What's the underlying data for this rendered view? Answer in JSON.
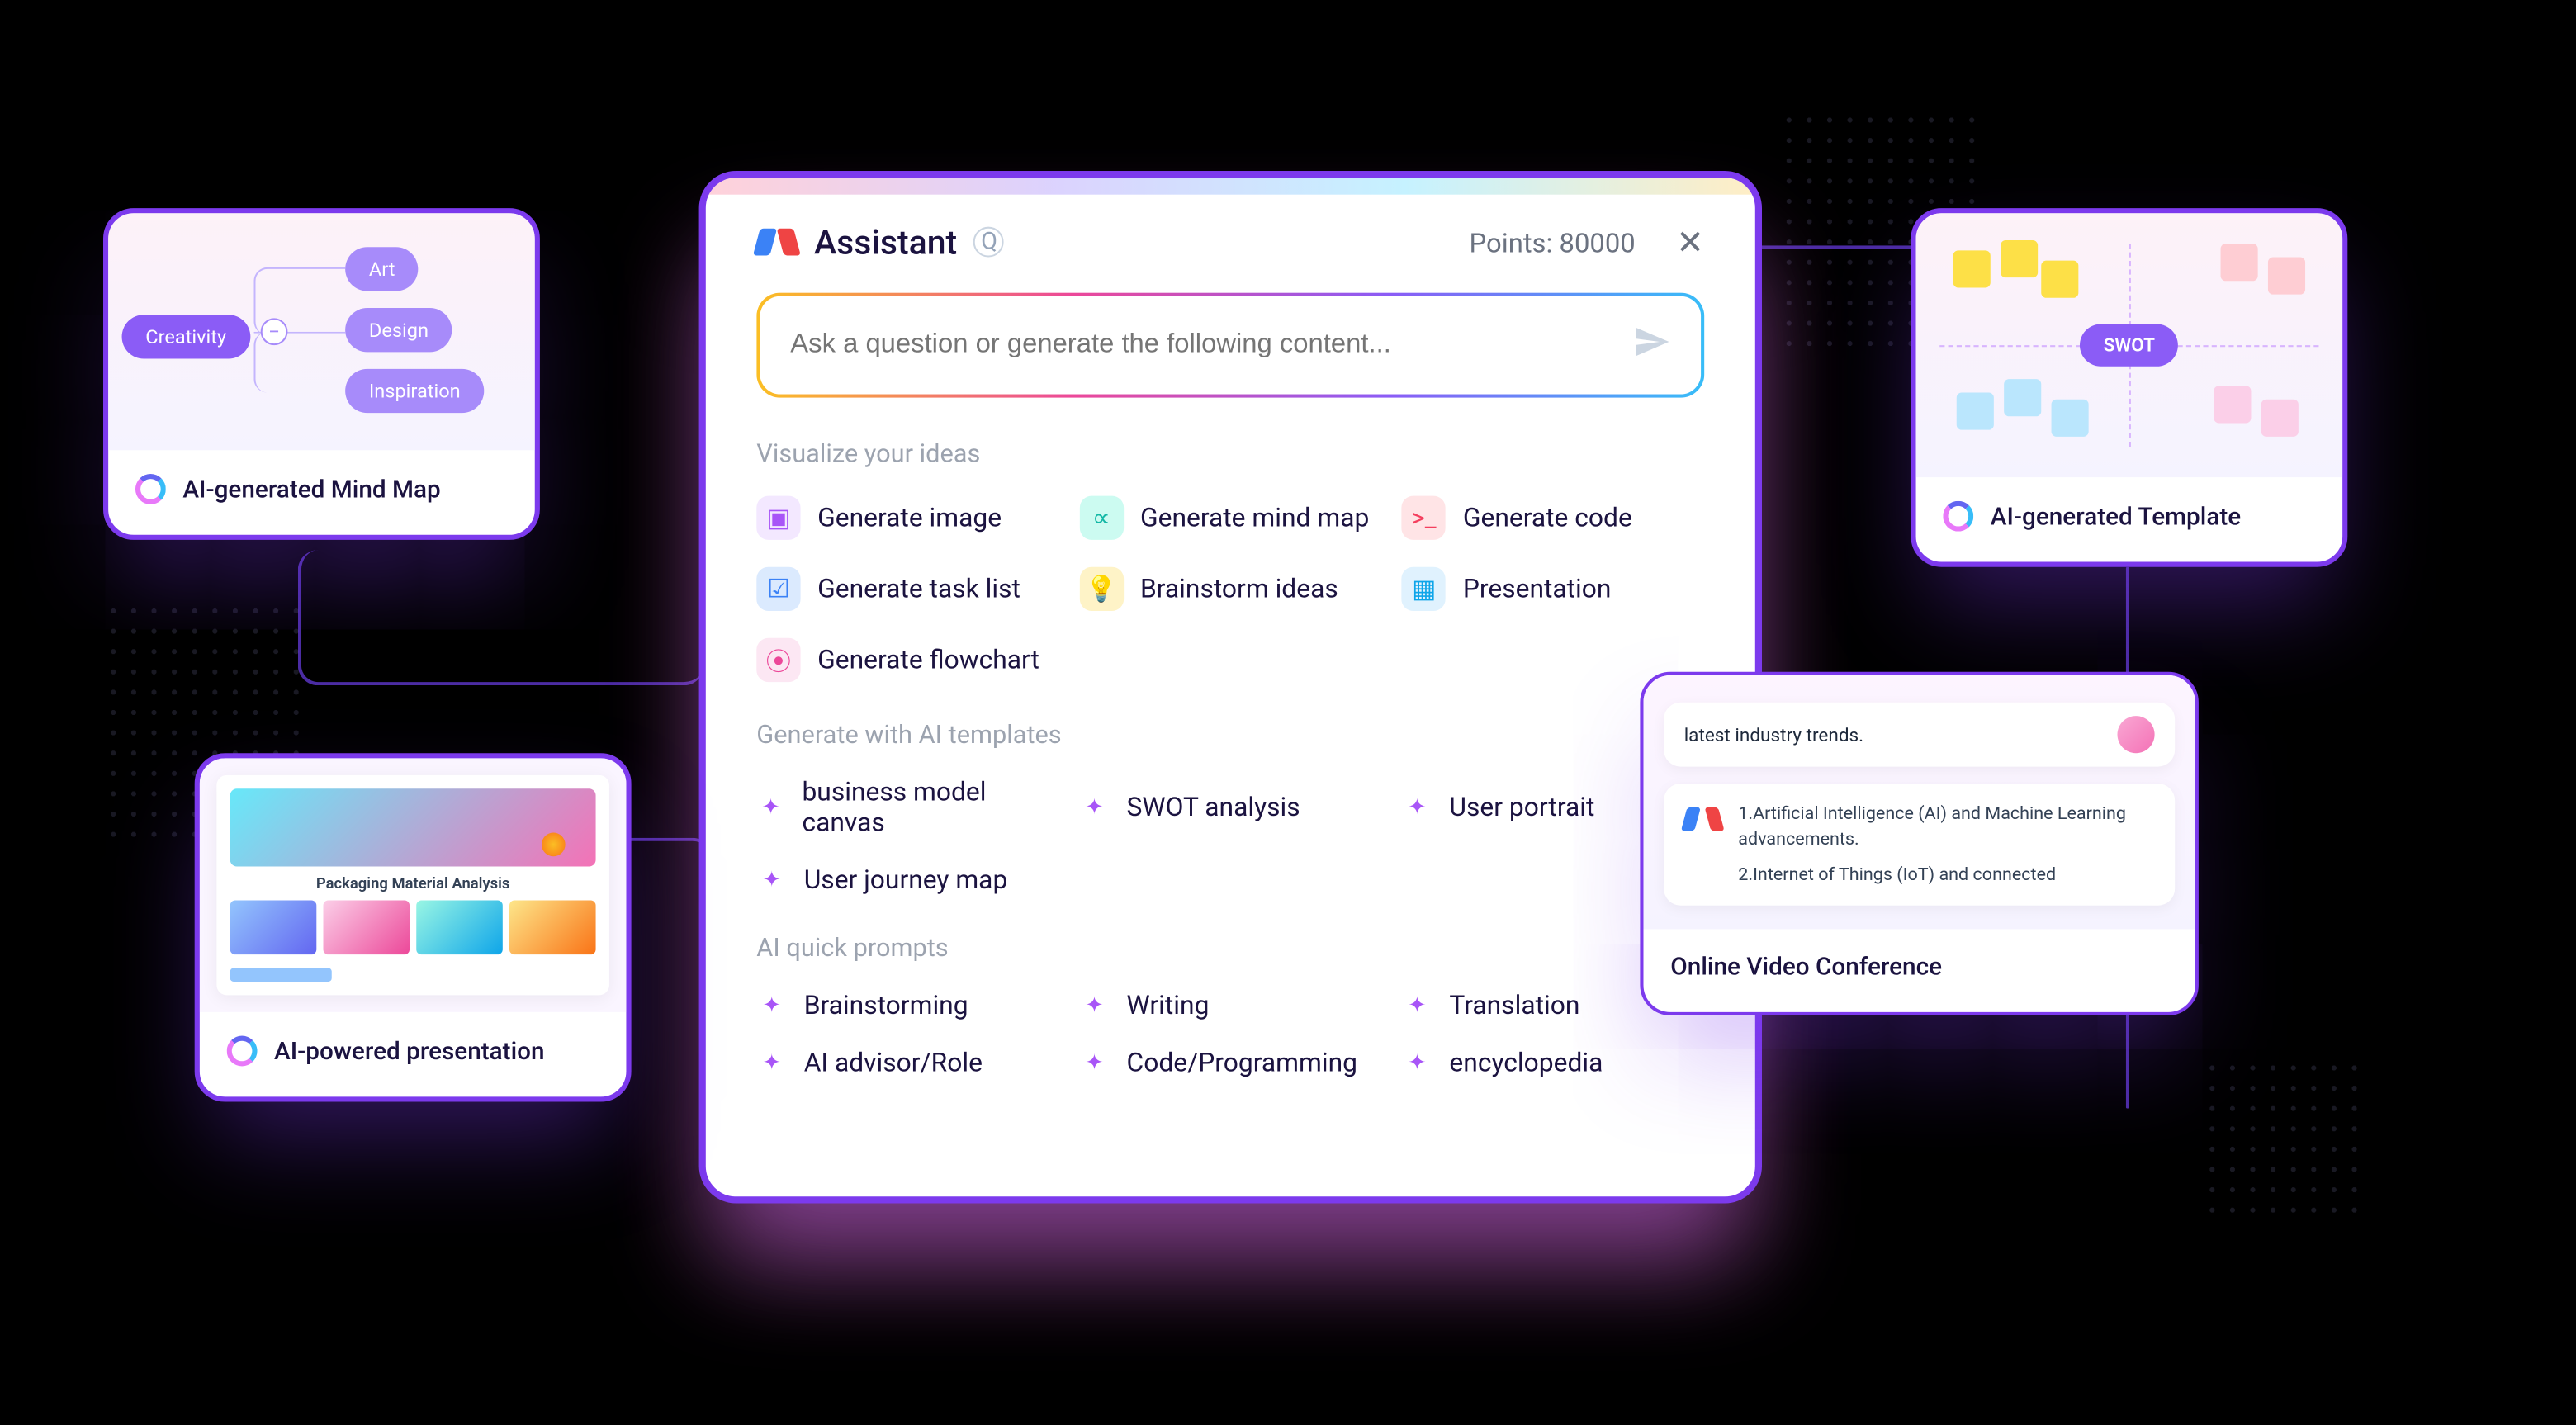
{
  "main": {
    "title": "Assistant",
    "points_label": "Points: 80000",
    "input_placeholder": "Ask a question or generate the following content...",
    "sections": {
      "visualize": {
        "heading": "Visualize your ideas",
        "items": {
          "image": "Generate image",
          "mindmap": "Generate mind map",
          "code": "Generate code",
          "tasklist": "Generate task list",
          "brainstorm": "Brainstorm ideas",
          "present": "Presentation",
          "flowchart": "Generate flowchart"
        }
      },
      "templates": {
        "heading": "Generate with AI templates",
        "items": {
          "bmc": "business model canvas",
          "swot": "SWOT analysis",
          "persona": "User portrait",
          "journey": "User journey map"
        }
      },
      "prompts": {
        "heading": "AI quick prompts",
        "items": {
          "brainstorm": "Brainstorming",
          "writing": "Writing",
          "translate": "Translation",
          "advisor": "AI advisor/Role",
          "codeprog": "Code/Programming",
          "encyc": "encyclopedia"
        }
      }
    }
  },
  "mindmap": {
    "caption": "AI-generated Mind Map",
    "root": "Creativity",
    "children": {
      "a": "Art",
      "b": "Design",
      "c": "Inspiration"
    }
  },
  "presentation": {
    "caption": "AI-powered presentation",
    "frame_title": "Packaging Material Analysis"
  },
  "template": {
    "caption": "AI-generated Template",
    "badge": "SWOT"
  },
  "video": {
    "caption": "Online Video Conference",
    "bubble": "latest industry trends.",
    "answer_1": "1.Artificial Intelligence (AI) and Machine Learning advancements.",
    "answer_2": "2.Internet of Things (IoT) and connected"
  }
}
